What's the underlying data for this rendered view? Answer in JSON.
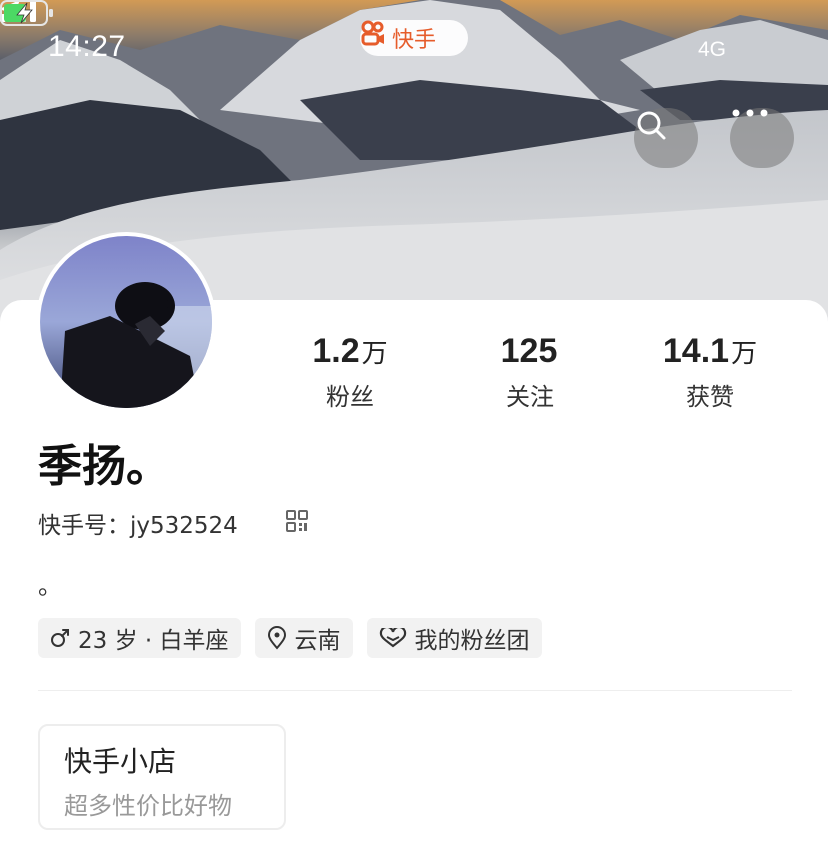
{
  "status_bar": {
    "time": "14:27",
    "network": "4G"
  },
  "app_badge": {
    "label": "快手",
    "icon": "kuaishou-logo-icon",
    "color": "#e65c2b"
  },
  "header_actions": {
    "search_icon": "search-icon",
    "more_icon": "more-icon"
  },
  "profile": {
    "name": "季扬。",
    "kwai_id": "快手号：jy532524",
    "bio": "。",
    "avatar": "avatar"
  },
  "stats": [
    {
      "value": "1.2",
      "unit": "万",
      "label": "粉丝"
    },
    {
      "value": "125",
      "unit": "",
      "label": "关注"
    },
    {
      "value": "14.1",
      "unit": "万",
      "label": "获赞"
    }
  ],
  "tags": {
    "age": "23 岁 · 白羊座",
    "location": "云南",
    "fan_club": "我的粉丝团"
  },
  "shop": {
    "title": "快手小店",
    "subtitle": "超多性价比好物"
  }
}
